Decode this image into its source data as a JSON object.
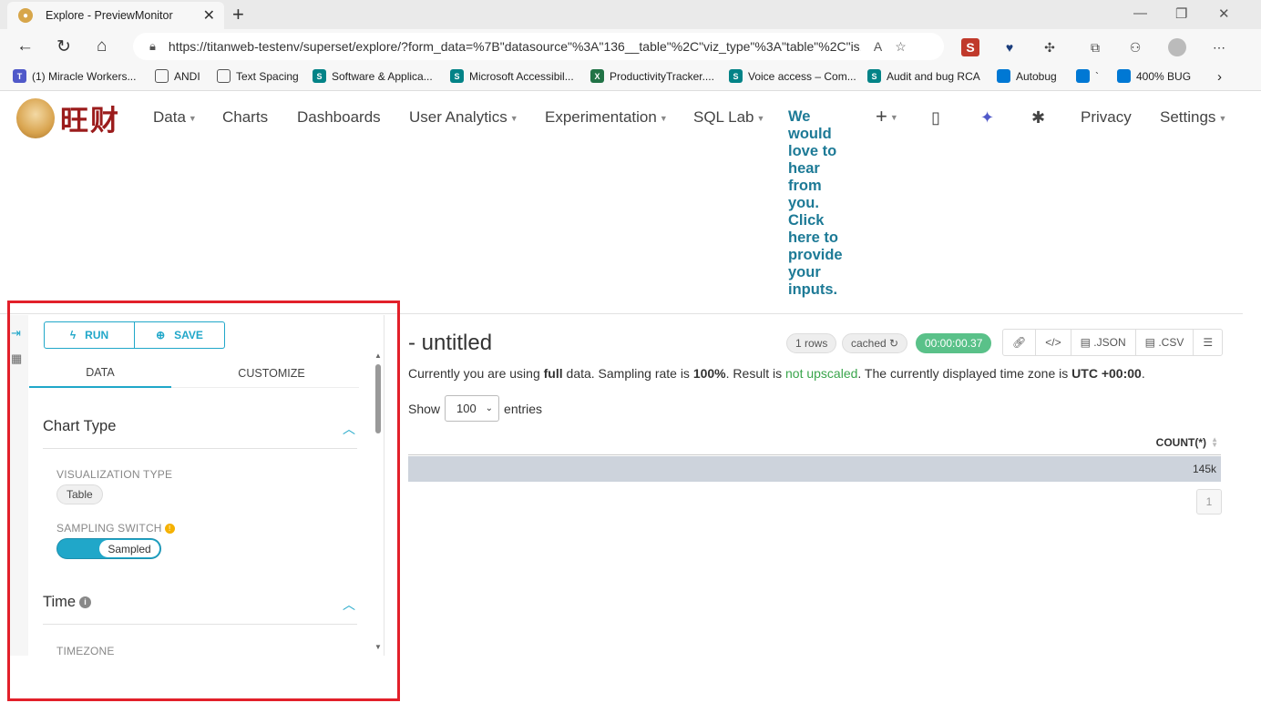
{
  "browser": {
    "tab_title": "Explore - PreviewMonitor",
    "url": "https://titanweb-testenv/superset/explore/?form_data=%7B\"datasource\"%3A\"136__table\"%2C\"viz_type\"%3A\"table\"%2C\"is...",
    "bookmarks": [
      {
        "label": "(1) Miracle Workers...",
        "color": "#5059c9"
      },
      {
        "label": "ANDI",
        "color": "#ffffff"
      },
      {
        "label": "Text Spacing",
        "color": "#ffffff"
      },
      {
        "label": "Software & Applica...",
        "color": "#038387"
      },
      {
        "label": "Microsoft Accessibil...",
        "color": "#038387"
      },
      {
        "label": "ProductivityTracker....",
        "color": "#217346"
      },
      {
        "label": "Voice access – Com...",
        "color": "#038387"
      },
      {
        "label": "Audit and bug RCA",
        "color": "#038387"
      },
      {
        "label": "Autobug",
        "color": "#0078d4"
      },
      {
        "label": "`",
        "color": "#0078d4"
      },
      {
        "label": "400% BUG",
        "color": "#0078d4"
      }
    ]
  },
  "app": {
    "logo_text": "旺财",
    "nav": {
      "data": "Data",
      "charts": "Charts",
      "dashboards": "Dashboards",
      "user_analytics": "User Analytics",
      "experimentation": "Experimentation",
      "sql_lab": "SQL Lab",
      "privacy": "Privacy",
      "settings": "Settings"
    },
    "feedback": "We would love to hear from you. Click here to provide your inputs."
  },
  "panel": {
    "run_label": "RUN",
    "save_label": "SAVE",
    "tab_data": "DATA",
    "tab_customize": "CUSTOMIZE",
    "chart_type_title": "Chart Type",
    "viz_type_label": "VISUALIZATION TYPE",
    "viz_type_value": "Table",
    "sampling_label": "SAMPLING SWITCH",
    "sampling_value": "Sampled",
    "time_title": "Time",
    "timezone_label": "TIMEZONE"
  },
  "main": {
    "title": "- untitled",
    "rows_badge": "1 rows",
    "cached_badge": "cached",
    "duration_badge": "00:00:00.37",
    "json_label": ".JSON",
    "csv_label": ".CSV",
    "info": {
      "p1": "Currently you are using ",
      "b1": "full",
      "p2": " data. Sampling rate is ",
      "b2": "100%",
      "p3": ". Result is ",
      "g1": "not upscaled",
      "p4": ". The currently displayed time zone is ",
      "b3": "UTC +00:00",
      "p5": "."
    },
    "show_label": "Show",
    "entries_value": "100",
    "entries_label": "entries",
    "column_header": "COUNT(*)",
    "cell_value": "145k",
    "page_number": "1"
  }
}
